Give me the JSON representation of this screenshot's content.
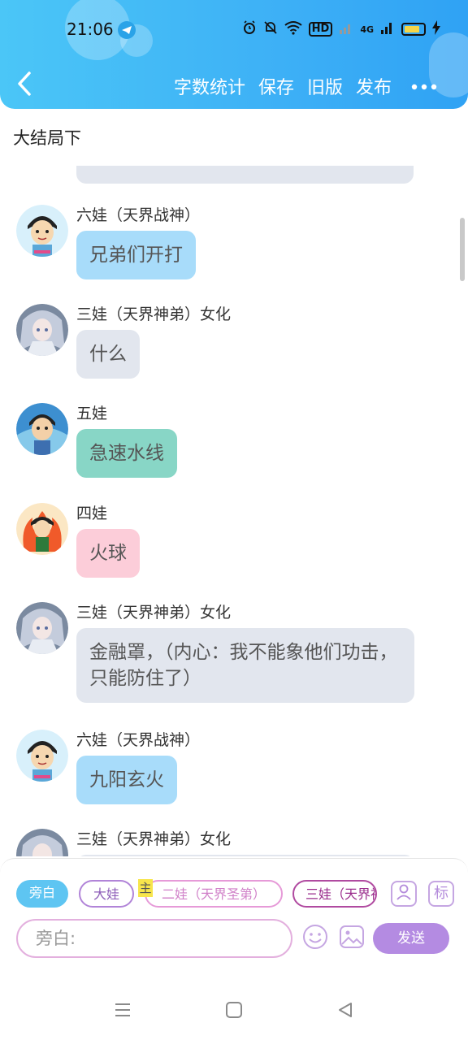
{
  "status_bar": {
    "time": "21:06",
    "network_label": "4G",
    "hd_label": "HD"
  },
  "header": {
    "actions": [
      "字数统计",
      "保存",
      "旧版",
      "发布"
    ]
  },
  "story_title": "大结局下",
  "messages": [
    {
      "sender": "六娃（天界战神）",
      "text": "兄弟们开打",
      "style": "blue",
      "avatar": "liuwa"
    },
    {
      "sender": "三娃（天界神弟）女化",
      "text": "什么",
      "style": "gray",
      "avatar": "sanwa"
    },
    {
      "sender": "五娃",
      "text": "急速水线",
      "style": "teal",
      "avatar": "wuwa"
    },
    {
      "sender": "四娃",
      "text": "火球",
      "style": "pink",
      "avatar": "siwa"
    },
    {
      "sender": "三娃（天界神弟）女化",
      "text": "金融罩，（内心：我不能象他们功击，只能防住了）",
      "style": "gray",
      "avatar": "sanwa"
    },
    {
      "sender": "六娃（天界战神）",
      "text": "九阳玄火",
      "style": "blue",
      "avatar": "liuwa"
    },
    {
      "sender": "三娃（天界神弟）女化",
      "text": "",
      "style": "gray",
      "avatar": "sanwa"
    }
  ],
  "role_chips": {
    "narration": "旁白",
    "dawa": "大娃",
    "main_tag": "主",
    "erwa": "二娃（天界圣第）",
    "sanwa": "三娃（天界神弟）女化"
  },
  "input": {
    "placeholder": "旁白:"
  },
  "send_label": "发送",
  "tag_button_label": "标",
  "colors": {
    "header_start": "#4bc6f7",
    "header_end": "#2fa2f4",
    "send_button": "#b48be2",
    "narration_chip": "#5ec5f2"
  }
}
